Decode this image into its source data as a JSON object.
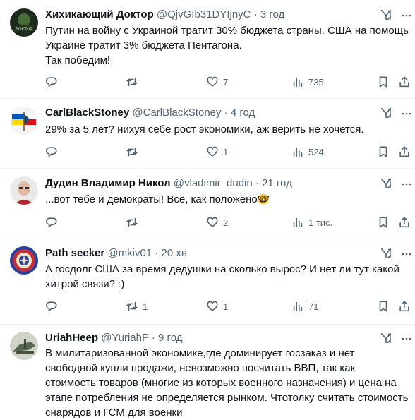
{
  "tweets": [
    {
      "name": "Хихикающий Доктор",
      "handle": "@QjvGIb31DYIjnyC",
      "dot": "·",
      "time": "3 год",
      "text_lines": [
        "Путин на войну с Украиной тратит 30% бюджета страны. США на помощь",
        "Украине тратит 3% бюджета Пентагона.",
        "Так победим!"
      ],
      "replies": "",
      "retweets": "",
      "likes": "7",
      "views": "735"
    },
    {
      "name": "CarlBlackStoney",
      "handle": "@CarlBlackStoney",
      "dot": "·",
      "time": "4 год",
      "text_lines": [
        "29% за 5 лет? нихуя себе рост экономики, аж верить не хочется."
      ],
      "replies": "",
      "retweets": "",
      "likes": "1",
      "views": "524"
    },
    {
      "name": "Дудин Владимир Никол",
      "handle": "@vladimir_dudin",
      "dot": "·",
      "time": "21 год",
      "text_lines": [
        "...вот тебе и демократы! Всё, как положено"
      ],
      "emoji": "🤓",
      "replies": "",
      "retweets": "",
      "likes": "2",
      "views": "1 тис."
    },
    {
      "name": "Path seeker",
      "handle": "@mkiv01",
      "dot": "·",
      "time": "20 хв",
      "text_lines": [
        "А госдолг США за время дедушки на сколько вырос? И нет ли тут какой",
        "хитрой связи? :)"
      ],
      "replies": "",
      "retweets": "1",
      "likes": "1",
      "views": "71"
    },
    {
      "name": "UriahHeep",
      "handle": "@YuriahP",
      "dot": "·",
      "time": "9 год",
      "text_lines": [
        "В милитаризованной экономике,где доминирует госзаказ и нет",
        "свободной купли продажи, невозможно посчитать ВВП, так как",
        "стоимость товаров (многие из которых военного назначения) и цена на",
        "этапе потребления не определяется рынком. Чтотолку считать стоимость",
        "снарядов и ГСМ для военки"
      ]
    }
  ],
  "avatar_texts": {
    "t0": "ДОКТОР"
  },
  "icons": {
    "reply": "reply-icon",
    "retweet": "retweet-icon",
    "like": "heart-icon",
    "views": "views-icon",
    "bookmark": "bookmark-icon",
    "share": "share-icon",
    "grok": "grok-icon",
    "more": "more-icon"
  },
  "colors": {
    "text": "#0f1419",
    "secondary": "#536471",
    "divider": "#eff3f4"
  }
}
